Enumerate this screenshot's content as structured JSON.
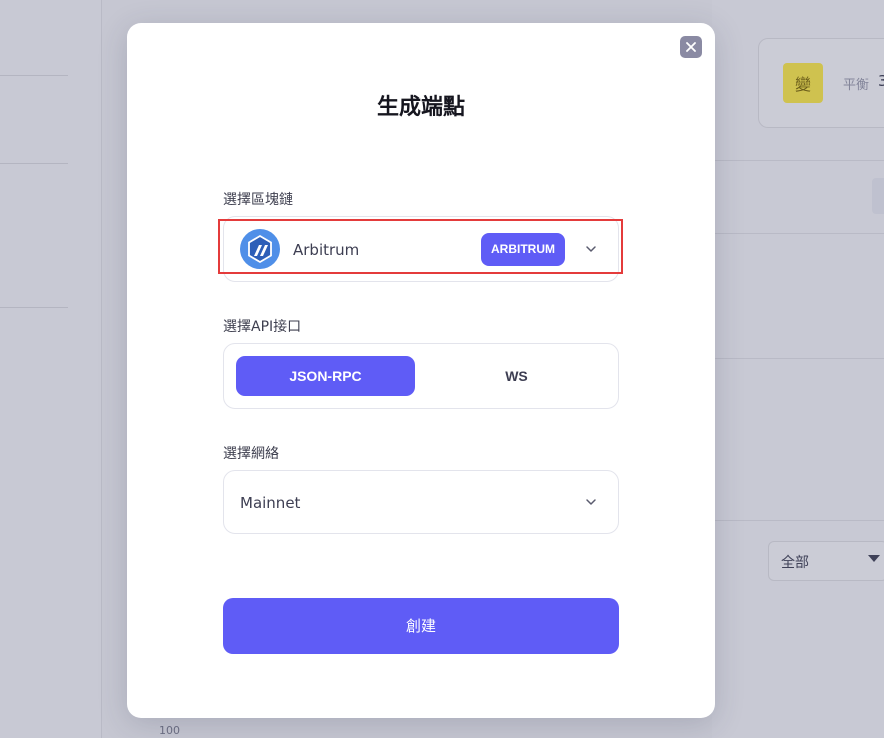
{
  "modal": {
    "title": "生成端點",
    "close_icon": "close-icon",
    "chain": {
      "label": "選擇區塊鏈",
      "selected_name": "Arbitrum",
      "badge": "ARBITRUM",
      "logo_icon": "arbitrum-logo-icon",
      "accent_color": "#5f5cf6"
    },
    "api": {
      "label": "選擇API接口",
      "options": [
        "JSON-RPC",
        "WS"
      ],
      "selected": "JSON-RPC"
    },
    "network": {
      "label": "選擇網絡",
      "selected": "Mainnet"
    },
    "create_label": "創建"
  },
  "background": {
    "balance_label": "平衡",
    "balance_value": "3",
    "coin_glyph": "變",
    "filter_select": "全部",
    "axis_tick": "100"
  }
}
